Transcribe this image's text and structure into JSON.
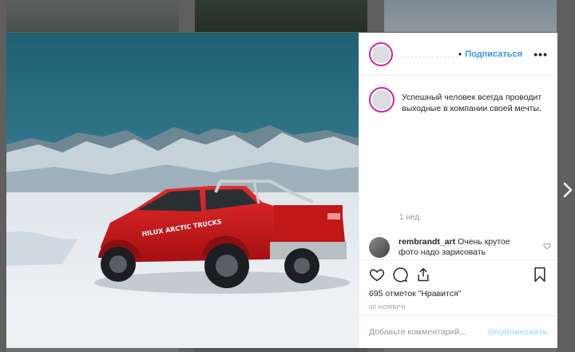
{
  "post": {
    "follow_label": "Подписаться",
    "more_label": "•••",
    "caption": "Успешный человек всегда проводит выходные в компании своей мечты.",
    "time_ago": "1 нед.",
    "comment": {
      "user": "rembrandt_art",
      "text": "Очень крутое фото надо зарисовать"
    },
    "likes": "695 отметок \"Нравится\"",
    "date": "30 НОЯБРЯ",
    "add_comment_placeholder": "Добавьте комментарий...",
    "publish_label": "Опубликовать",
    "truck_text": "HILUX ARCTIC TRUCKS"
  },
  "icons": [
    "heart-icon",
    "comment-icon",
    "share-icon",
    "bookmark-icon",
    "more-icon",
    "chevron-right-icon"
  ],
  "colors": {
    "accent": "#3897f0",
    "publish_disabled": "#b2dffc",
    "truck_red": "#d51c1c"
  }
}
